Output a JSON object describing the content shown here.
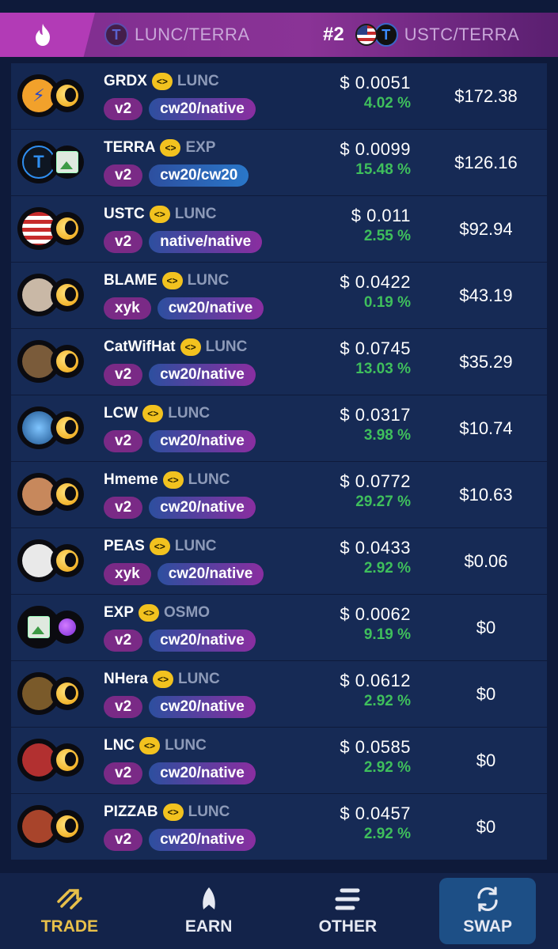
{
  "ticker": [
    {
      "rank": "",
      "pair": "LUNC/TERRA"
    },
    {
      "rank": "#2",
      "pair": "USTC/TERRA"
    }
  ],
  "rows": [
    {
      "name": "GRDX",
      "base": "LUNC",
      "ver": "v2",
      "type": "cw20/native",
      "price": "$ 0.0051",
      "change": "4.02 %",
      "value": "$172.38",
      "avatar": "grdx-logo",
      "sub": "luna"
    },
    {
      "name": "TERRA",
      "base": "EXP",
      "ver": "v2",
      "type": "cw20/cw20",
      "price": "$ 0.0099",
      "change": "15.48 %",
      "value": "$126.16",
      "avatar": "terra-logo",
      "sub": "image"
    },
    {
      "name": "USTC",
      "base": "LUNC",
      "ver": "v2",
      "type": "native/native",
      "price": "$ 0.011",
      "change": "2.55 %",
      "value": "$92.94",
      "avatar": "us-flag",
      "sub": "luna"
    },
    {
      "name": "BLAME",
      "base": "LUNC",
      "ver": "xyk",
      "type": "cw20/native",
      "price": "$ 0.0422",
      "change": "0.19 %",
      "value": "$43.19",
      "avatar": "blame-logo",
      "sub": "luna"
    },
    {
      "name": "CatWifHat",
      "base": "LUNC",
      "ver": "v2",
      "type": "cw20/native",
      "price": "$ 0.0745",
      "change": "13.03 %",
      "value": "$35.29",
      "avatar": "cat-logo",
      "sub": "luna"
    },
    {
      "name": "LCW",
      "base": "LUNC",
      "ver": "v2",
      "type": "cw20/native",
      "price": "$ 0.0317",
      "change": "3.98 %",
      "value": "$10.74",
      "avatar": "globe-logo",
      "sub": "luna"
    },
    {
      "name": "Hmeme",
      "base": "LUNC",
      "ver": "v2",
      "type": "cw20/native",
      "price": "$ 0.0772",
      "change": "29.27 %",
      "value": "$10.63",
      "avatar": "hamster-logo",
      "sub": "luna"
    },
    {
      "name": "PEAS",
      "base": "LUNC",
      "ver": "xyk",
      "type": "cw20/native",
      "price": "$ 0.0433",
      "change": "2.92 %",
      "value": "$0.06",
      "avatar": "person-logo",
      "sub": "luna"
    },
    {
      "name": "EXP",
      "base": "OSMO",
      "ver": "v2",
      "type": "cw20/native",
      "price": "$ 0.0062",
      "change": "9.19 %",
      "value": "$0",
      "avatar": "image",
      "sub": "potion"
    },
    {
      "name": "NHera",
      "base": "LUNC",
      "ver": "v2",
      "type": "cw20/native",
      "price": "$ 0.0612",
      "change": "2.92 %",
      "value": "$0",
      "avatar": "hera-logo",
      "sub": "luna"
    },
    {
      "name": "LNC",
      "base": "LUNC",
      "ver": "v2",
      "type": "cw20/native",
      "price": "$ 0.0585",
      "change": "2.92 %",
      "value": "$0",
      "avatar": "lnc-logo",
      "sub": "luna"
    },
    {
      "name": "PIZZAB",
      "base": "LUNC",
      "ver": "v2",
      "type": "cw20/native",
      "price": "$ 0.0457",
      "change": "2.92 %",
      "value": "$0",
      "avatar": "pizza-logo",
      "sub": "luna"
    }
  ],
  "nav": [
    {
      "label": "TRADE",
      "icon": "trade-arrows-icon",
      "active": true
    },
    {
      "label": "EARN",
      "icon": "rocket-icon",
      "active": false
    },
    {
      "label": "OTHER",
      "icon": "menu-icon",
      "active": false
    },
    {
      "label": "SWAP",
      "icon": "refresh-icon",
      "active": false
    }
  ],
  "colors": {
    "accent": "#e8c04a",
    "positive": "#3fbf5c",
    "row_bg": "#162a55",
    "topbar": "#8a3396"
  }
}
